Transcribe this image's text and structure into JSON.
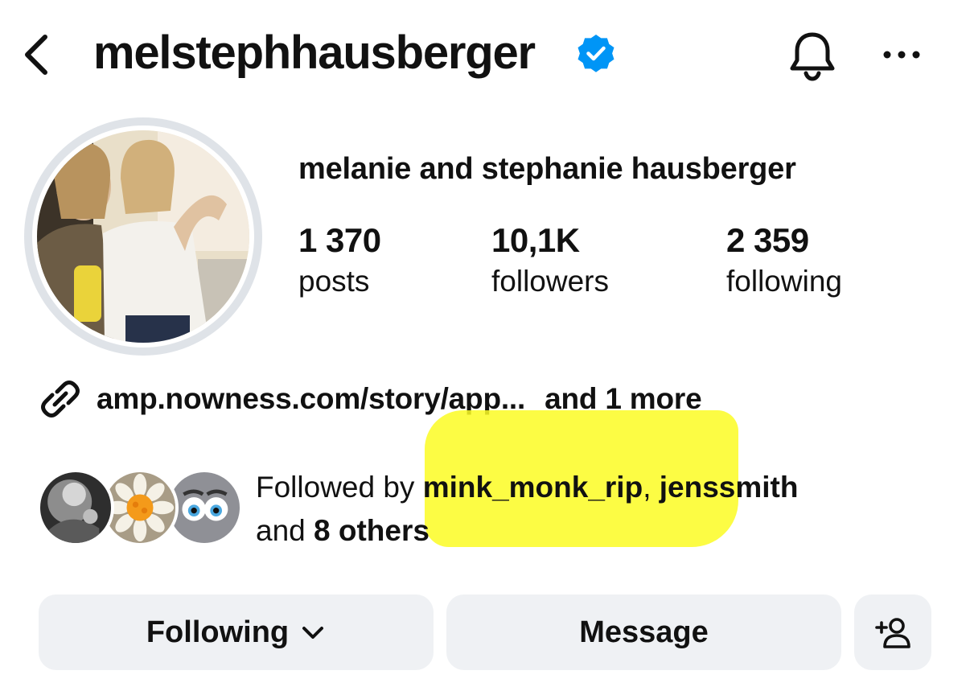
{
  "header": {
    "username": "melstephhausberger",
    "verified": true,
    "icons": {
      "back": "back-chevron-icon",
      "verified": "verified-badge-icon",
      "notifications": "bell-icon",
      "more": "more-options-icon"
    }
  },
  "profile": {
    "full_name": "melanie and stephanie hausberger",
    "stats": [
      {
        "value": "1 370",
        "label": "posts"
      },
      {
        "value": "10,1K",
        "label": "followers"
      },
      {
        "value": "2 359",
        "label": "following"
      }
    ]
  },
  "links": {
    "primary": "amp.nowness.com/story/app...",
    "more": "and 1 more"
  },
  "followed_by": {
    "prefix": "Followed by ",
    "user1": "mink_monk_rip",
    "separator": ", ",
    "user2": "jenssmith",
    "and": "and ",
    "others": "8 others"
  },
  "actions": {
    "following_label": "Following",
    "message_label": "Message",
    "add_user_icon": "add-person-icon"
  },
  "colors": {
    "verified_blue": "#0095f6",
    "button_bg": "#eff1f4",
    "highlight": "#fbfb25",
    "text": "#111111"
  }
}
